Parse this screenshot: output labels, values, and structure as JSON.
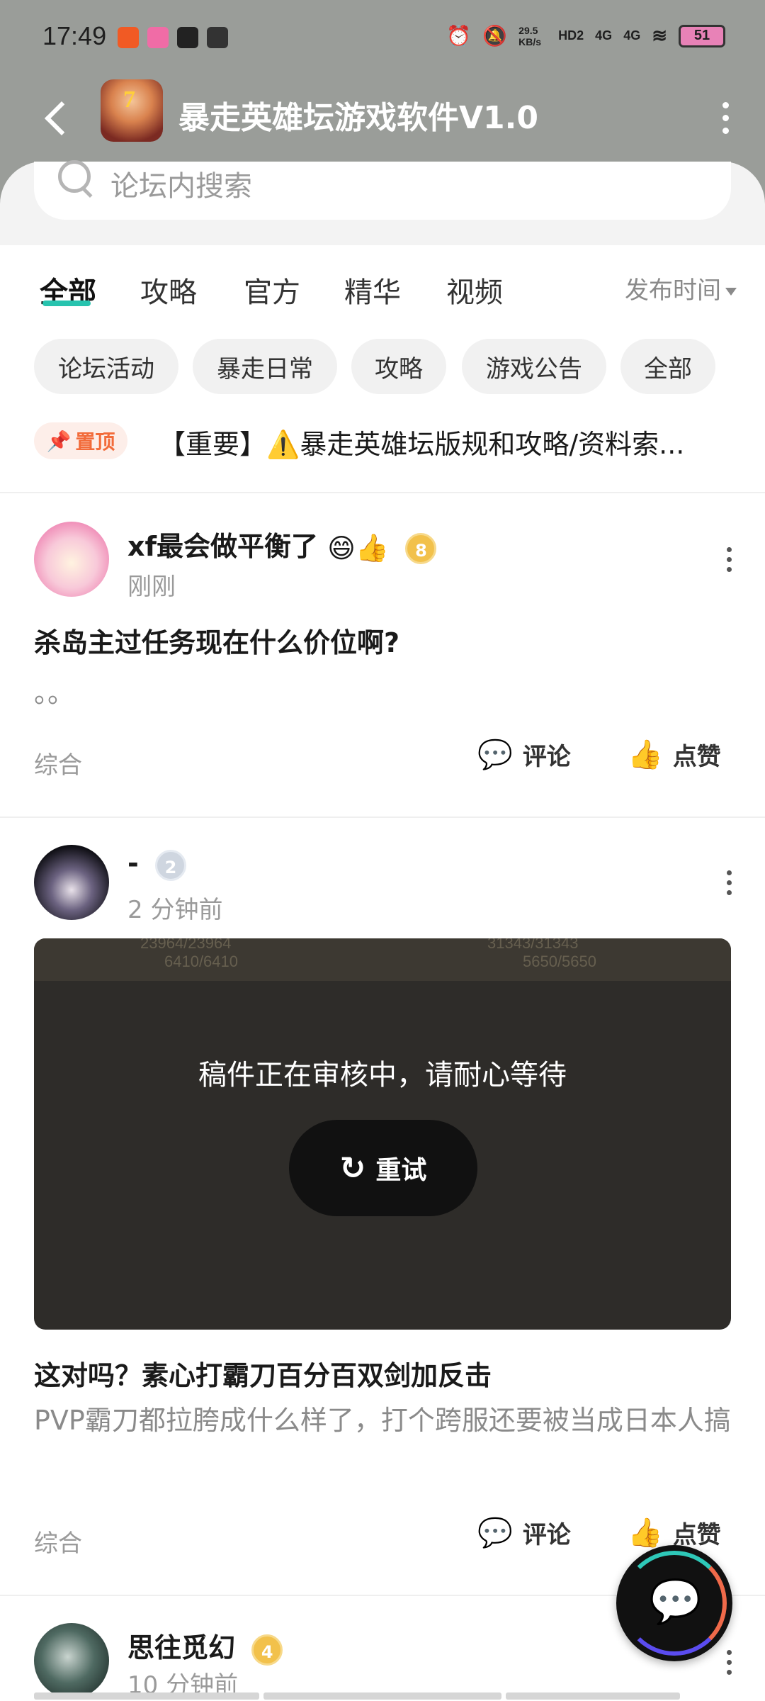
{
  "status_bar": {
    "time": "17:49",
    "net_speed": "29.5 KB/s",
    "hd": "HD2",
    "sim1": "4G",
    "sim2": "4G",
    "battery": "51"
  },
  "header": {
    "title": "暴走英雄坛游戏软件V1.0"
  },
  "search": {
    "placeholder": "论坛内搜索"
  },
  "tabs": [
    {
      "label": "全部",
      "active": true
    },
    {
      "label": "攻略"
    },
    {
      "label": "官方"
    },
    {
      "label": "精华"
    },
    {
      "label": "视频"
    }
  ],
  "sort": {
    "label": "发布时间"
  },
  "chips": [
    "论坛活动",
    "暴走日常",
    "攻略",
    "游戏公告",
    "全部"
  ],
  "pinned": {
    "badge": "置顶",
    "text_pre": "【重要】",
    "text": "暴走英雄坛版规和攻略/资料索..."
  },
  "posts": [
    {
      "author": "xf最会做平衡了",
      "level": "8",
      "time": "刚刚",
      "title": "杀岛主过任务现在什么价位啊?",
      "body": "。。",
      "category": "综合",
      "comment": "评论",
      "like": "点赞"
    },
    {
      "author": "-",
      "level": "2",
      "time": "2 分钟前",
      "media_msg": "稿件正在审核中，请耐心等待",
      "retry": "重试",
      "media_stats": [
        "23964/23964",
        "6410/6410",
        "31343/31343",
        "5650/5650"
      ],
      "title": "这对吗？素心打霸刀百分百双剑加反击",
      "body": "PVP霸刀都拉胯成什么样了，打个跨服还要被当成日本人搞",
      "category": "综合",
      "comment": "评论",
      "like": "点赞"
    },
    {
      "author": "思往觅幻",
      "level": "4",
      "time": "10 分钟前"
    }
  ],
  "colors": {
    "accent": "#27c3ae",
    "header_bg": "#9a9d99",
    "pin": "#f26b3a"
  }
}
